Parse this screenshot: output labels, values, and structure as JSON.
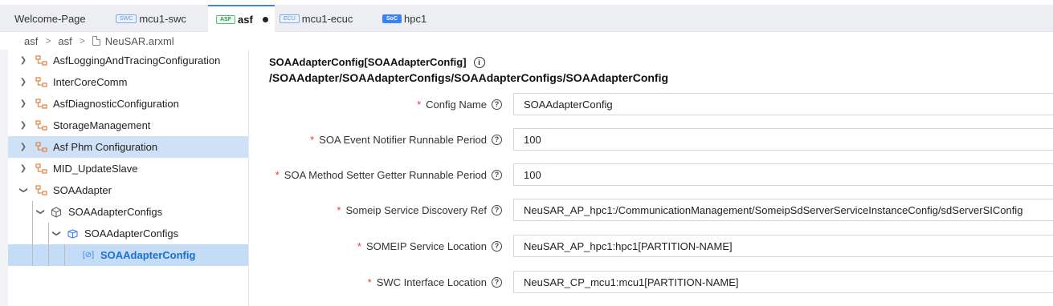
{
  "tabs": [
    {
      "label": "Welcome-Page",
      "badge": "",
      "active": false
    },
    {
      "label": "mcu1-swc",
      "badge": "SWC",
      "active": false
    },
    {
      "label": "asf",
      "badge": "ASF",
      "active": true,
      "dirty": true
    },
    {
      "label": "mcu1-ecuc",
      "badge": "ECU",
      "active": false
    },
    {
      "label": "hpc1",
      "badge": "SoC",
      "active": false
    }
  ],
  "breadcrumb": {
    "items": [
      "asf",
      "asf"
    ],
    "file": "NeuSAR.arxml"
  },
  "tree": {
    "items": [
      {
        "label": "AsfLoggingAndTracingConfiguration",
        "expanded": false
      },
      {
        "label": "InterCoreComm",
        "expanded": false
      },
      {
        "label": "AsfDiagnosticConfiguration",
        "expanded": false
      },
      {
        "label": "StorageManagement",
        "expanded": false
      },
      {
        "label": "Asf Phm Configuration",
        "expanded": false,
        "highlighted": true
      },
      {
        "label": "MID_UpdateSlave",
        "expanded": false
      },
      {
        "label": "SOAAdapter",
        "expanded": true
      },
      {
        "label": "SOAAdapterConfigs",
        "expanded": true
      },
      {
        "label": "SOAAdapterConfigs",
        "expanded": true
      },
      {
        "label": "SOAAdapterConfig",
        "selected": true
      }
    ]
  },
  "header": {
    "title": "SOAAdapterConfig[SOAAdapterConfig]",
    "path": "/SOAAdapter/SOAAdapterConfigs/SOAAdapterConfigs/SOAAdapterConfig"
  },
  "form": {
    "fields": [
      {
        "label": "Config Name",
        "value": "SOAAdapterConfig"
      },
      {
        "label": "SOA Event Notifier Runnable Period",
        "value": "100"
      },
      {
        "label": "SOA Method Setter Getter Runnable Period",
        "value": "100"
      },
      {
        "label": "Someip Service Discovery Ref",
        "value": "NeuSAR_AP_hpc1:/CommunicationManagement/SomeipSdServerServiceInstanceConfig/sdServerSIConfig"
      },
      {
        "label": "SOMEIP Service Location",
        "value": "NeuSAR_AP_hpc1:hpc1[PARTITION-NAME]"
      },
      {
        "label": "SWC Interface Location",
        "value": "NeuSAR_CP_mcu1:mcu1[PARTITION-NAME]"
      }
    ]
  },
  "colors": {
    "accent": "#3b82f6",
    "selection": "#c5dcf7",
    "required": "#e53935",
    "node_icon": "#e08a4a"
  }
}
